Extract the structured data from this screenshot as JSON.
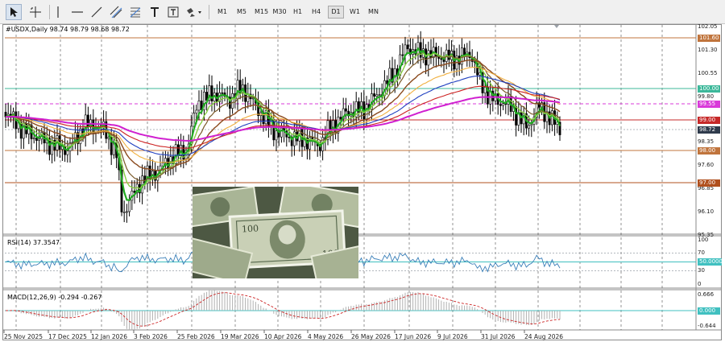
{
  "toolbar": {
    "tools": [
      {
        "name": "cursor-tool-button",
        "icon": "cursor-icon",
        "active": true
      },
      {
        "name": "crosshair-tool-button",
        "icon": "crosshair-icon",
        "active": false
      },
      {
        "name": "vertical-line-tool-button",
        "icon": "vertical-line-icon",
        "active": false
      },
      {
        "name": "horizontal-line-tool-button",
        "icon": "horizontal-line-icon",
        "active": false
      },
      {
        "name": "trendline-tool-button",
        "icon": "trendline-icon",
        "active": false
      },
      {
        "name": "equidistant-channel-button",
        "icon": "channel-icon",
        "active": false
      },
      {
        "name": "fibonacci-tool-button",
        "icon": "fibonacci-icon",
        "active": false
      },
      {
        "name": "text-tool-button",
        "icon": "text-icon",
        "active": false
      },
      {
        "name": "text-label-tool-button",
        "icon": "text-label-icon",
        "active": false
      },
      {
        "name": "shapes-dropdown-button",
        "icon": "shapes-icon",
        "active": false
      }
    ],
    "timeframes": [
      "M1",
      "M5",
      "M15",
      "M30",
      "H1",
      "H4",
      "D1",
      "W1",
      "MN"
    ],
    "active_timeframe": "D1"
  },
  "chart": {
    "header": "#USDX,Daily  98.74 98.79 98.68 98.72",
    "price_ticks": [
      "102.05",
      "101.30",
      "100.55",
      "99.80",
      "98.35",
      "97.60",
      "96.85",
      "96.10",
      "95.35"
    ],
    "price_tags": [
      {
        "text": "101.60",
        "color": "#c0743c"
      },
      {
        "text": "100.00",
        "color": "#3cb89a"
      },
      {
        "text": "99.55",
        "color": "#d93ad9"
      },
      {
        "text": "99.00",
        "color": "#c62828"
      },
      {
        "text": "98.72",
        "color": "#2f3b4c"
      },
      {
        "text": "98.00",
        "color": "#c0743c"
      },
      {
        "text": "97.00",
        "color": "#b0501e"
      }
    ],
    "date_labels": [
      "25 Nov 2025",
      "17 Dec 2025",
      "12 Jan 2026",
      "3 Feb 2026",
      "25 Feb 2026",
      "19 Mar 2026",
      "10 Apr 2026",
      "4 May 2026",
      "26 May 2026",
      "17 Jun 2026",
      "9 Jul 2026",
      "31 Jul 2026",
      "24 Aug 2026"
    ],
    "photo_icon": "dollar-banknotes-image"
  },
  "rsi": {
    "header": "RSI(14) 37.3547",
    "ticks": [
      "100",
      "70",
      "50.0000",
      "30",
      "0"
    ],
    "level_color": "#40c0c0"
  },
  "macd": {
    "header": "MACD(12,26,9) -0.294 -0.267",
    "ticks": [
      "0.666",
      "0.000",
      "-0.644"
    ],
    "signal_color": "#cc2222",
    "histogram_color": "#b0b0b0"
  }
}
